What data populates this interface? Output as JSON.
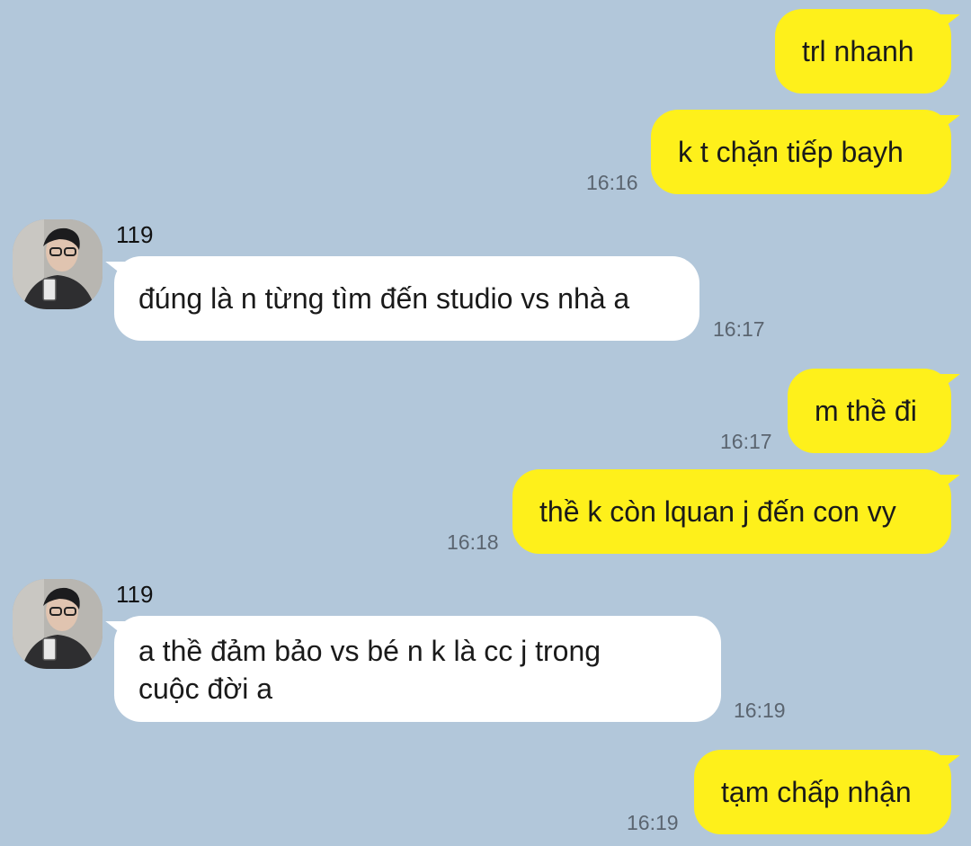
{
  "contact": {
    "name": "119",
    "avatar_icon": "profile-photo-avatar"
  },
  "colors": {
    "background": "#b2c7da",
    "outgoing_bubble": "#fef01b",
    "incoming_bubble": "#ffffff",
    "timestamp": "#5b6570"
  },
  "messages": [
    {
      "side": "out",
      "text": "trl nhanh",
      "time": ""
    },
    {
      "side": "out",
      "text": "k t chặn tiếp bayh",
      "time": "16:16"
    },
    {
      "side": "in",
      "sender": "119",
      "text": "đúng là n từng tìm đến studio vs nhà a",
      "time": "16:17"
    },
    {
      "side": "out",
      "text": "m thề đi",
      "time": "16:17"
    },
    {
      "side": "out",
      "text": "thề k còn lquan j đến con vy",
      "time": "16:18"
    },
    {
      "side": "in",
      "sender": "119",
      "text_line1": "a thề đảm bảo vs bé n k là cc j trong",
      "text_line2": "cuộc đời a",
      "time": "16:19"
    },
    {
      "side": "out",
      "text": "tạm chấp nhận",
      "time": "16:19"
    }
  ]
}
